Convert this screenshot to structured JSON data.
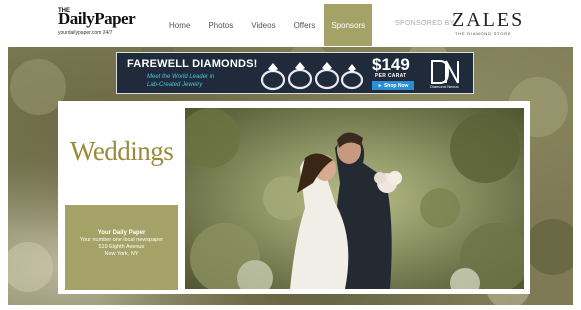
{
  "header": {
    "logo_the": "THE",
    "logo_main": "DailyPaper",
    "logo_sub": "yourdailypaper.com 24/7",
    "nav": [
      {
        "label": "Home",
        "active": false
      },
      {
        "label": "Photos",
        "active": false
      },
      {
        "label": "Videos",
        "active": false
      },
      {
        "label": "Offers",
        "active": false
      },
      {
        "label": "Sponsors",
        "active": true
      }
    ],
    "sponsored_label": "SPONSORED BY",
    "sponsor_name": "ZALES",
    "sponsor_tagline": "THE DIAMOND STORE"
  },
  "ad": {
    "headline": "FAREWELL DIAMONDS!",
    "subline_1": "Meet the World Leader in",
    "subline_2": "Lab-Created Jewelry",
    "price": "$149",
    "price_unit": "PER CARAT",
    "cta": "► Shop Now",
    "brand": "Diamond Nexus",
    "colors": {
      "bg": "#1f2b3a",
      "accent": "#4fc3e0",
      "cta": "#2a8fd6"
    }
  },
  "main": {
    "title": "Weddings",
    "info": {
      "name": "Your Daily Paper",
      "line1": "Your number one local newspaper",
      "line2": "519 Eighth Avenue",
      "line3": "New York, NY"
    },
    "colors": {
      "accent": "#a5a268",
      "title": "#9a8a3a"
    }
  }
}
